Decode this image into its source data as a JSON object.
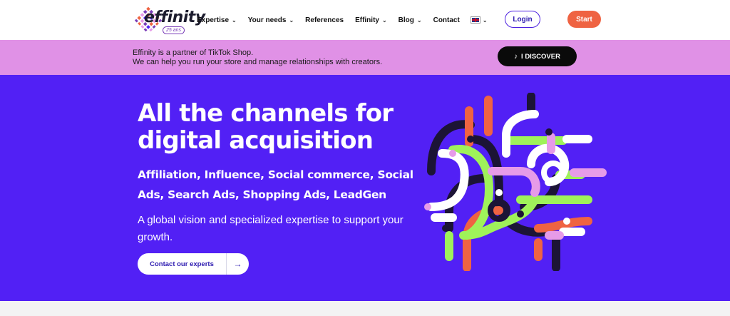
{
  "nav": {
    "logo_word": "effinity",
    "logo_badge": "25 ans",
    "menu": [
      {
        "label": "Expertise",
        "dropdown": true
      },
      {
        "label": "Your needs",
        "dropdown": true
      },
      {
        "label": "References",
        "dropdown": false
      },
      {
        "label": "Effinity",
        "dropdown": true
      },
      {
        "label": "Blog",
        "dropdown": true
      },
      {
        "label": "Contact",
        "dropdown": false
      }
    ],
    "language_flag": "uk-flag-icon",
    "login_label": "Login",
    "start_label": "Start"
  },
  "banner": {
    "line1": "Effinity is a partner of TikTok Shop.",
    "line2": "We can help you run your store and manage relationships with creators.",
    "button_label": "I DISCOVER",
    "button_icon": "tiktok-icon"
  },
  "hero": {
    "title_line1": "All the channels for",
    "title_line2": "digital acquisition",
    "subtitle": "Affiliation, Influence, Social commerce, Social Ads, Search Ads, Shopping Ads, LeadGen",
    "description": "A global vision and specialized expertise to support your growth.",
    "cta_label": "Contact our experts",
    "cta_icon": "arrow-right-icon"
  },
  "colors": {
    "hero_bg": "#5220f5",
    "banner_bg": "#e091e6",
    "accent_orange": "#ef6342",
    "accent_green": "#9ff25a",
    "accent_pink": "#e69be8",
    "dark": "#1c1436"
  }
}
